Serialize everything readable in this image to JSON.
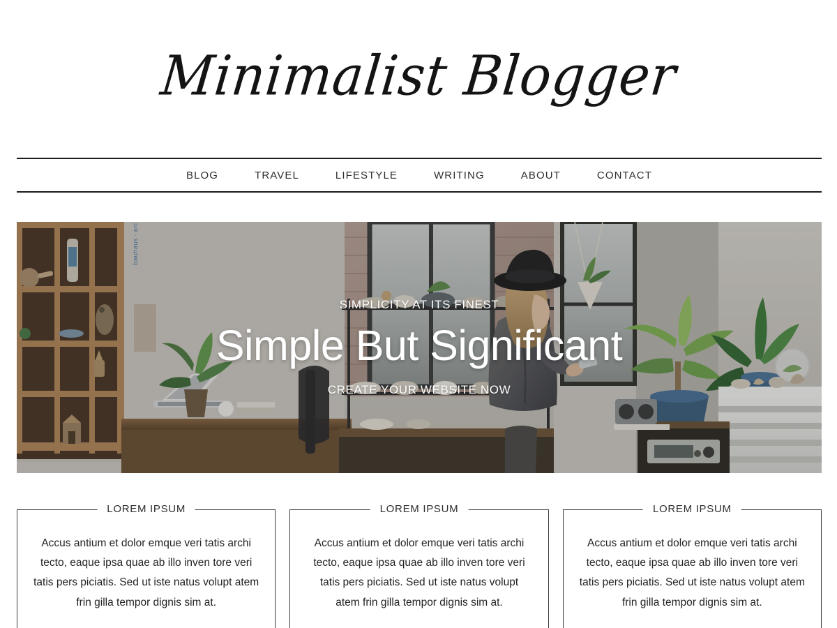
{
  "site": {
    "title": "Minimalist Blogger"
  },
  "nav": {
    "items": [
      {
        "label": "BLOG"
      },
      {
        "label": "TRAVEL"
      },
      {
        "label": "LIFESTYLE"
      },
      {
        "label": "WRITING"
      },
      {
        "label": "ABOUT"
      },
      {
        "label": "CONTACT"
      }
    ]
  },
  "hero": {
    "eyebrow": "SIMPLICITY AT ITS FINEST",
    "title": "Simple But Significant",
    "cta": "CREATE YOUR WEBSITE NOW",
    "image_alt": "Woman in black hat and grey cardigan standing by a window in a plant-filled home office with wooden shelving, laptop and stereo"
  },
  "cards": [
    {
      "title": "LOREM IPSUM",
      "body": "Accus antium et dolor emque veri tatis archi tecto, eaque ipsa quae ab illo inven tore veri tatis pers piciatis. Sed ut iste natus volupt atem frin gilla tempor dignis sim at."
    },
    {
      "title": "LOREM IPSUM",
      "body": "Accus antium et dolor emque veri tatis archi tecto, eaque ipsa quae ab illo inven tore veri tatis pers piciatis. Sed ut iste natus volupt atem frin gilla tempor dignis sim at."
    },
    {
      "title": "LOREM IPSUM",
      "body": "Accus antium et dolor emque veri tatis archi tecto, eaque ipsa quae ab illo inven tore veri tatis pers piciatis. Sed ut iste natus volupt atem frin gilla tempor dignis sim at."
    }
  ],
  "colors": {
    "text": "#232323",
    "rule": "#1a1a1a",
    "hero_text": "#ffffff",
    "card_border": "#3a3a3a",
    "background": "#ffffff"
  }
}
